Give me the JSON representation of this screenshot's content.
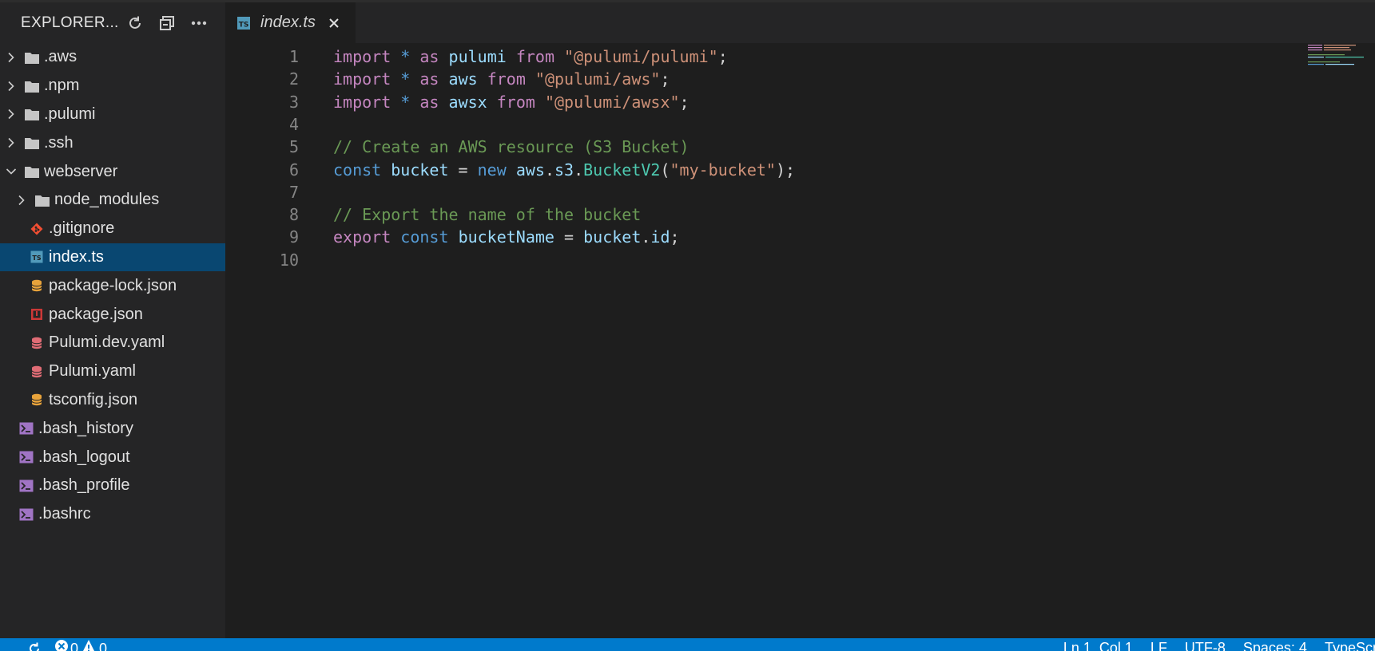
{
  "sidebar": {
    "title": "EXPLORER...",
    "items": [
      {
        "label": ".aws",
        "kind": "folder",
        "expanded": false,
        "depth": 0
      },
      {
        "label": ".npm",
        "kind": "folder",
        "expanded": false,
        "depth": 0
      },
      {
        "label": ".pulumi",
        "kind": "folder",
        "expanded": false,
        "depth": 0
      },
      {
        "label": ".ssh",
        "kind": "folder",
        "expanded": false,
        "depth": 0
      },
      {
        "label": "webserver",
        "kind": "folder",
        "expanded": true,
        "depth": 0
      },
      {
        "label": "node_modules",
        "kind": "folder",
        "expanded": false,
        "depth": 1
      },
      {
        "label": ".gitignore",
        "kind": "git-file",
        "depth": 1
      },
      {
        "label": "index.ts",
        "kind": "ts-file",
        "depth": 1,
        "selected": true
      },
      {
        "label": "package-lock.json",
        "kind": "json-file",
        "depth": 1
      },
      {
        "label": "package.json",
        "kind": "npm-file",
        "depth": 1
      },
      {
        "label": "Pulumi.dev.yaml",
        "kind": "yaml-file",
        "depth": 1
      },
      {
        "label": "Pulumi.yaml",
        "kind": "yaml-file",
        "depth": 1
      },
      {
        "label": "tsconfig.json",
        "kind": "json-file",
        "depth": 1
      },
      {
        "label": ".bash_history",
        "kind": "shell-file",
        "depth": 0
      },
      {
        "label": ".bash_logout",
        "kind": "shell-file",
        "depth": 0
      },
      {
        "label": ".bash_profile",
        "kind": "shell-file",
        "depth": 0
      },
      {
        "label": ".bashrc",
        "kind": "shell-file",
        "depth": 0
      }
    ]
  },
  "editor": {
    "tab": {
      "label": "index.ts",
      "icon": "typescript-icon",
      "icon_text": "TS"
    },
    "lines": [
      [
        [
          "import",
          "kw-ctrl"
        ],
        [
          " ",
          "plain"
        ],
        [
          "*",
          "kw"
        ],
        [
          " ",
          "plain"
        ],
        [
          "as",
          "kw-ctrl"
        ],
        [
          " ",
          "plain"
        ],
        [
          "pulumi",
          "var"
        ],
        [
          " ",
          "plain"
        ],
        [
          "from",
          "kw-ctrl"
        ],
        [
          " ",
          "plain"
        ],
        [
          "\"@pulumi/pulumi\"",
          "str"
        ],
        [
          ";",
          "plain"
        ]
      ],
      [
        [
          "import",
          "kw-ctrl"
        ],
        [
          " ",
          "plain"
        ],
        [
          "*",
          "kw"
        ],
        [
          " ",
          "plain"
        ],
        [
          "as",
          "kw-ctrl"
        ],
        [
          " ",
          "plain"
        ],
        [
          "aws",
          "var"
        ],
        [
          " ",
          "plain"
        ],
        [
          "from",
          "kw-ctrl"
        ],
        [
          " ",
          "plain"
        ],
        [
          "\"@pulumi/aws\"",
          "str"
        ],
        [
          ";",
          "plain"
        ]
      ],
      [
        [
          "import",
          "kw-ctrl"
        ],
        [
          " ",
          "plain"
        ],
        [
          "*",
          "kw"
        ],
        [
          " ",
          "plain"
        ],
        [
          "as",
          "kw-ctrl"
        ],
        [
          " ",
          "plain"
        ],
        [
          "awsx",
          "var"
        ],
        [
          " ",
          "plain"
        ],
        [
          "from",
          "kw-ctrl"
        ],
        [
          " ",
          "plain"
        ],
        [
          "\"@pulumi/awsx\"",
          "str"
        ],
        [
          ";",
          "plain"
        ]
      ],
      [],
      [
        [
          "// Create an AWS resource (S3 Bucket)",
          "cmt"
        ]
      ],
      [
        [
          "const",
          "kw"
        ],
        [
          " ",
          "plain"
        ],
        [
          "bucket",
          "var"
        ],
        [
          " = ",
          "plain"
        ],
        [
          "new",
          "kw"
        ],
        [
          " ",
          "plain"
        ],
        [
          "aws",
          "var"
        ],
        [
          ".",
          "plain"
        ],
        [
          "s3",
          "var"
        ],
        [
          ".",
          "plain"
        ],
        [
          "BucketV2",
          "type"
        ],
        [
          "(",
          "plain"
        ],
        [
          "\"my-bucket\"",
          "str"
        ],
        [
          ");",
          "plain"
        ]
      ],
      [],
      [
        [
          "// Export the name of the bucket",
          "cmt"
        ]
      ],
      [
        [
          "export",
          "kw-ctrl"
        ],
        [
          " ",
          "plain"
        ],
        [
          "const",
          "kw"
        ],
        [
          " ",
          "plain"
        ],
        [
          "bucketName",
          "var"
        ],
        [
          " = ",
          "plain"
        ],
        [
          "bucket",
          "var"
        ],
        [
          ".",
          "plain"
        ],
        [
          "id",
          "var"
        ],
        [
          ";",
          "plain"
        ]
      ],
      []
    ]
  },
  "statusbar": {
    "errors": "0",
    "warnings": "0",
    "position": "Ln 1, Col 1",
    "eol": "LF",
    "encoding": "UTF-8",
    "indent": "Spaces: 4",
    "language": "TypeScript"
  },
  "colors": {
    "selection": "#094771",
    "statusbar": "#007acc",
    "sidebar": "#252526",
    "editor": "#1e1e1e"
  }
}
